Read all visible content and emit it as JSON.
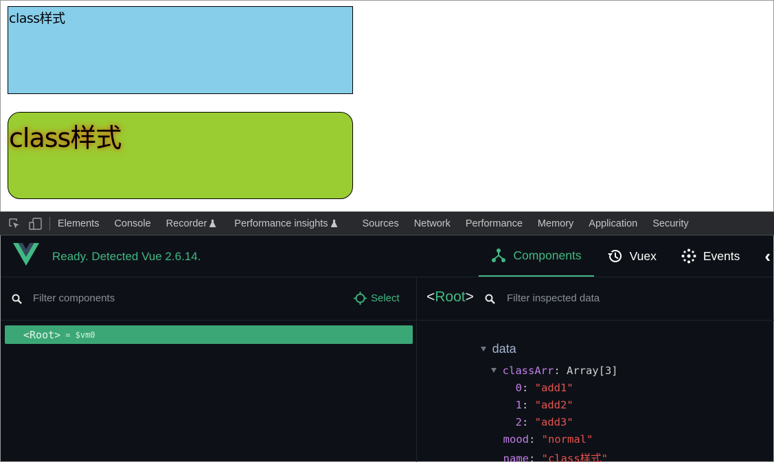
{
  "page": {
    "box1_text": "class样式",
    "box2_text": "class样式"
  },
  "devtools": {
    "tabs": [
      {
        "label": "Elements",
        "flask": false
      },
      {
        "label": "Console",
        "flask": false
      },
      {
        "label": "Recorder",
        "flask": true
      },
      {
        "label": "Performance insights",
        "flask": true
      },
      {
        "label": "Sources",
        "flask": false
      },
      {
        "label": "Network",
        "flask": false
      },
      {
        "label": "Performance",
        "flask": false
      },
      {
        "label": "Memory",
        "flask": false
      },
      {
        "label": "Application",
        "flask": false
      },
      {
        "label": "Security",
        "flask": false
      }
    ]
  },
  "vue": {
    "status": "Ready. Detected Vue 2.6.14.",
    "nav": {
      "components": "Components",
      "vuex": "Vuex",
      "events": "Events",
      "more": "‹"
    },
    "left": {
      "filter_placeholder": "Filter components",
      "select_label": "Select",
      "root_tag_open": "<",
      "root_name": "Root",
      "root_tag_close": ">",
      "root_alias": "= $vm0"
    },
    "right": {
      "title_open": "<",
      "title_name": "Root",
      "title_close": ">",
      "filter_placeholder": "Filter inspected data",
      "section": "data",
      "classArr_key": "classArr",
      "classArr_type": "Array[3]",
      "items": [
        {
          "key": "0",
          "value": "\"add1\""
        },
        {
          "key": "1",
          "value": "\"add2\""
        },
        {
          "key": "2",
          "value": "\"add3\""
        }
      ],
      "mood_key": "mood",
      "mood_value": "\"normal\"",
      "name_key": "name",
      "name_value": "\"class样式\""
    }
  },
  "colors": {
    "vue_green": "#42b883",
    "box1_bg": "#87ceeb",
    "box2_bg": "#9acd32",
    "panel_bg": "#0d1117",
    "tabbar_bg": "#292a2d"
  }
}
